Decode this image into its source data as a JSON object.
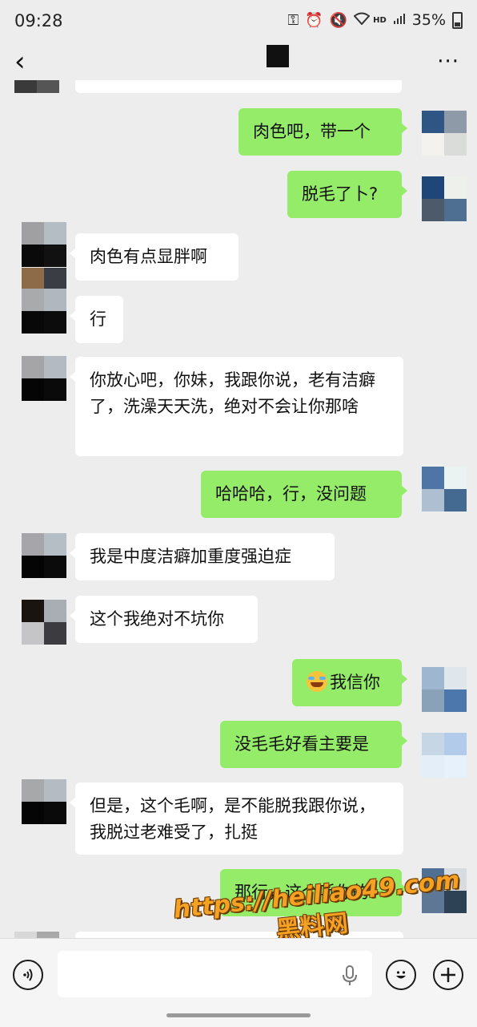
{
  "status": {
    "time": "09:28",
    "battery": "35%",
    "network": "HD",
    "icons": [
      "key-icon",
      "alarm-icon",
      "mute-icon",
      "wifi-icon",
      "signal-icon",
      "battery-icon"
    ]
  },
  "nav": {
    "back_icon": "‹",
    "more_icon": "···"
  },
  "messages": [
    {
      "side": "out",
      "text": "肉色吧，带一个"
    },
    {
      "side": "out",
      "text": "脱毛了卜?"
    },
    {
      "side": "in",
      "text": "肉色有点显胖啊"
    },
    {
      "side": "in",
      "text": "行"
    },
    {
      "side": "in",
      "text": "你放心吧，你妹，我跟你说，老有洁癖了，洗澡天天洗，绝对不会让你那啥"
    },
    {
      "side": "out",
      "text": "哈哈哈，行，没问题"
    },
    {
      "side": "in",
      "text": "我是中度洁癖加重度强迫症"
    },
    {
      "side": "in",
      "text": "这个我绝对不坑你"
    },
    {
      "side": "out",
      "text": "我信你",
      "emoji": "laugh-cry-emoji"
    },
    {
      "side": "out",
      "text": "没毛毛好看主要是"
    },
    {
      "side": "in",
      "text": "但是，这个毛啊，是不能脱我跟你说，我脱过老难受了，扎挺"
    },
    {
      "side": "out",
      "text": "那行，这个听你的"
    }
  ],
  "watermark": {
    "url": "https://heiliao49.com",
    "name": "黑料网"
  },
  "input": {
    "value": "",
    "placeholder": ""
  },
  "colors": {
    "background": "#ededed",
    "outgoing_bubble": "#95ec69",
    "incoming_bubble": "#ffffff"
  }
}
